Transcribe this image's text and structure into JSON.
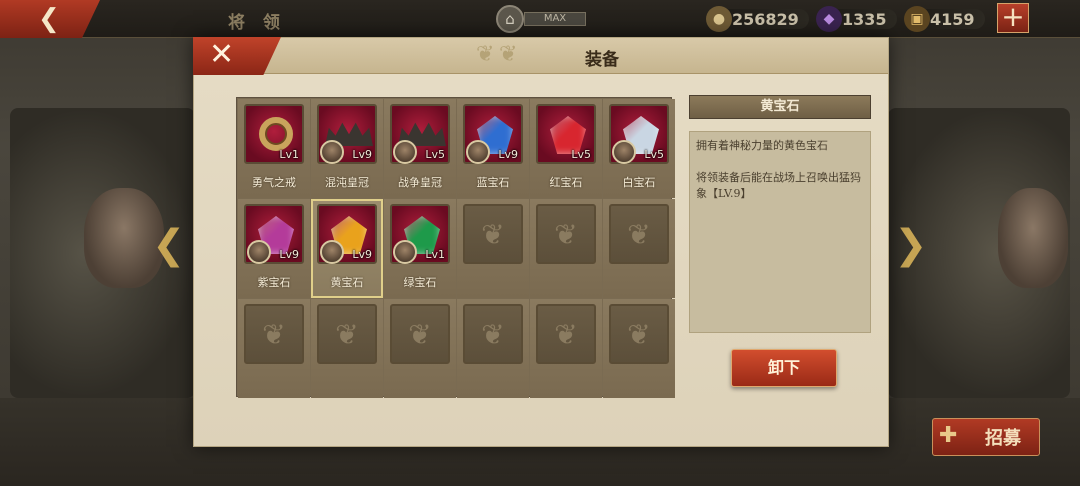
{
  "topbar": {
    "title": "将 领",
    "max_label": "MAX",
    "resources": [
      {
        "icon": "coin-icon",
        "value": "256829",
        "color": "#b08a4a"
      },
      {
        "icon": "purple-gem-icon",
        "value": "1335",
        "color": "#7a3fa6"
      },
      {
        "icon": "treasure-chest-icon",
        "value": "4159",
        "color": "#b6863a"
      }
    ]
  },
  "modal": {
    "title": "装备",
    "items": [
      {
        "name": "勇气之戒",
        "level": "Lv1",
        "kind": "ring",
        "has_avatar": false
      },
      {
        "name": "混沌皇冠",
        "level": "Lv9",
        "kind": "crown",
        "has_avatar": true
      },
      {
        "name": "战争皇冠",
        "level": "Lv5",
        "kind": "crown",
        "has_avatar": true
      },
      {
        "name": "蓝宝石",
        "level": "Lv9",
        "kind": "gem",
        "gem_color": "#2f6ed1",
        "has_avatar": true
      },
      {
        "name": "红宝石",
        "level": "Lv5",
        "kind": "gem",
        "gem_color": "#d8262f",
        "has_avatar": false
      },
      {
        "name": "白宝石",
        "level": "Lv5",
        "kind": "gem",
        "gem_color": "#c9d6e3",
        "has_avatar": true
      },
      {
        "name": "紫宝石",
        "level": "Lv9",
        "kind": "gem",
        "gem_color": "#b43b9a",
        "has_avatar": true
      },
      {
        "name": "黄宝石",
        "level": "Lv9",
        "kind": "gem",
        "gem_color": "#e9a21c",
        "has_avatar": true,
        "selected": true
      },
      {
        "name": "绿宝石",
        "level": "Lv1",
        "kind": "gem",
        "gem_color": "#1e9a4a",
        "has_avatar": true
      }
    ],
    "detail": {
      "title": "黄宝石",
      "desc1": "拥有着神秘力量的黄色宝石",
      "desc2": "将领装备后能在战场上召唤出猛犸象【LV.9】"
    },
    "unequip_label": "卸下"
  },
  "bottom": {
    "recruit_label": "招募"
  }
}
